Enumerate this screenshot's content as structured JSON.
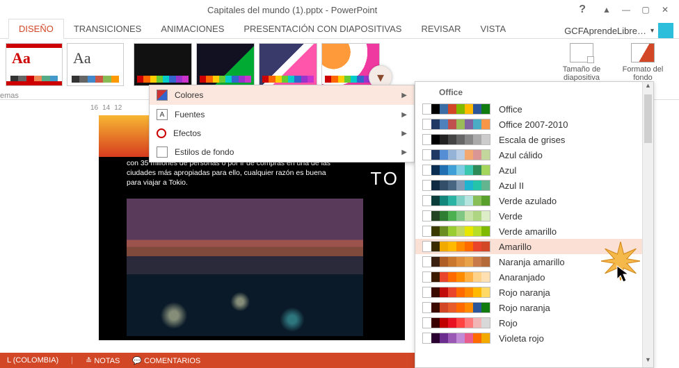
{
  "window": {
    "title": "Capitales del mundo (1).pptx - PowerPoint"
  },
  "account": {
    "name": "GCFAprendeLibre…"
  },
  "tabs": {
    "design": "DISEÑO",
    "transitions": "TRANSICIONES",
    "animations": "ANIMACIONES",
    "slideshow": "PRESENTACIÓN CON DIAPOSITIVAS",
    "review": "REVISAR",
    "view": "VISTA"
  },
  "ribbon": {
    "slide_size": "Tamaño de diapositiva",
    "format_bg": "Formato del fondo",
    "themes_group_label": "emas"
  },
  "ruler": {
    "t16": "16",
    "t14": "14",
    "t12": "12"
  },
  "variant_menu": {
    "colors": "Colores",
    "fonts": "Fuentes",
    "effects": "Efectos",
    "bg_styles": "Estilos de fondo"
  },
  "slide": {
    "body": "con 35 millones de personas o por ir de compras en una de las ciudades más apropiadas para ello, cualquier razón es buena para viajar a Tokio.",
    "title_right": "TO"
  },
  "colors_panel": {
    "header": "Office",
    "schemes": [
      {
        "name": "Office",
        "c": [
          "#fff",
          "#000",
          "#3a6ea5",
          "#d24726",
          "#7fba00",
          "#ffb900",
          "#2b579a",
          "#107c10"
        ]
      },
      {
        "name": "Office 2007-2010",
        "c": [
          "#fff",
          "#203864",
          "#4f81bd",
          "#c0504d",
          "#9bbb59",
          "#8064a2",
          "#4bacc6",
          "#f79646"
        ]
      },
      {
        "name": "Escala de grises",
        "c": [
          "#fff",
          "#000",
          "#222",
          "#444",
          "#666",
          "#888",
          "#aaa",
          "#ccc"
        ]
      },
      {
        "name": "Azul cálido",
        "c": [
          "#fff",
          "#203864",
          "#558ed5",
          "#95b3d7",
          "#b9cde5",
          "#f2a86f",
          "#d99694",
          "#c3d69b"
        ]
      },
      {
        "name": "Azul",
        "c": [
          "#fff",
          "#0a2e52",
          "#1f6fb2",
          "#3ea0d6",
          "#7fcde4",
          "#3ac9b0",
          "#2e8b57",
          "#a4d65e"
        ]
      },
      {
        "name": "Azul II",
        "c": [
          "#fff",
          "#102a43",
          "#334e68",
          "#486581",
          "#829ab1",
          "#1db4d0",
          "#25c4a9",
          "#62b58f"
        ]
      },
      {
        "name": "Verde azulado",
        "c": [
          "#fff",
          "#0b3d3a",
          "#13877b",
          "#2bb3a3",
          "#7fd1c6",
          "#b5e5de",
          "#88c057",
          "#5aa02c"
        ]
      },
      {
        "name": "Verde",
        "c": [
          "#fff",
          "#224422",
          "#2e7d32",
          "#4caf50",
          "#81c784",
          "#c5e1a5",
          "#aed581",
          "#dcedc8"
        ]
      },
      {
        "name": "Verde amarillo",
        "c": [
          "#fff",
          "#3a3a00",
          "#6b8e23",
          "#9acd32",
          "#c0d860",
          "#e6e600",
          "#b7dd29",
          "#7fba00"
        ]
      },
      {
        "name": "Amarillo",
        "c": [
          "#fff",
          "#3a2a00",
          "#f2a900",
          "#ffb900",
          "#ff8c00",
          "#ff6a00",
          "#e8452c",
          "#d24726"
        ]
      },
      {
        "name": "Naranja amarillo",
        "c": [
          "#fff",
          "#3a2010",
          "#b05e27",
          "#c9762e",
          "#de8e3c",
          "#e8a24a",
          "#c97a4a",
          "#b56a3a"
        ]
      },
      {
        "name": "Anaranjado",
        "c": [
          "#fff",
          "#3a1a00",
          "#e8452c",
          "#ff6a00",
          "#ff8c00",
          "#ffb144",
          "#ffd28a",
          "#ffe0b3"
        ]
      },
      {
        "name": "Rojo naranja",
        "c": [
          "#fff",
          "#3a0a00",
          "#c10c0c",
          "#e8452c",
          "#ff6a00",
          "#ff8c00",
          "#ffb900",
          "#ffd966"
        ]
      },
      {
        "name": "Rojo naranja",
        "c": [
          "#fff",
          "#3a0a00",
          "#d24726",
          "#e85c2c",
          "#ff6a00",
          "#ff8c00",
          "#2b579a",
          "#107c10"
        ]
      },
      {
        "name": "Rojo",
        "c": [
          "#fff",
          "#3a0000",
          "#c00000",
          "#e81123",
          "#ff4343",
          "#ff7a7a",
          "#f2b5b5",
          "#d8d8d8"
        ]
      },
      {
        "name": "Violeta rojo",
        "c": [
          "#fff",
          "#2a0030",
          "#6b2e8e",
          "#9b59b6",
          "#c18bd8",
          "#e85c8e",
          "#ff6a00",
          "#f2a900"
        ]
      }
    ]
  },
  "status": {
    "locale": "L (COLOMBIA)",
    "notes": "NOTAS",
    "comments": "COMENTARIOS"
  }
}
